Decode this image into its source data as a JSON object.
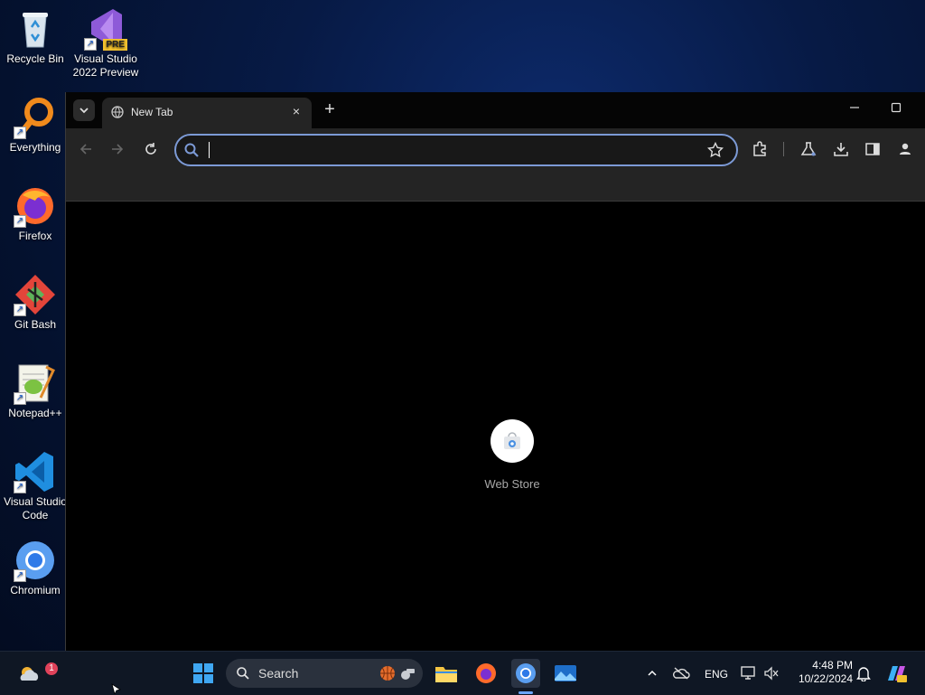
{
  "desktop": {
    "icons": [
      {
        "label": "Recycle Bin",
        "icon": "recycle-bin-icon"
      },
      {
        "label": "Visual Studio 2022 Preview",
        "icon": "visual-studio-icon",
        "badge": "PRE"
      },
      {
        "label": "Everything",
        "icon": "everything-search-icon"
      },
      {
        "label": "Firefox",
        "icon": "firefox-icon"
      },
      {
        "label": "Git Bash",
        "icon": "git-bash-icon"
      },
      {
        "label": "Notepad++",
        "icon": "notepad-plus-plus-icon"
      },
      {
        "label": "Visual Studio Code",
        "icon": "vscode-icon"
      },
      {
        "label": "Chromium",
        "icon": "chromium-icon"
      }
    ]
  },
  "browser": {
    "tab": {
      "title": "New Tab",
      "close": "×"
    },
    "new_tab_symbol": "+",
    "omnibox": {
      "value": "",
      "placeholder": ""
    },
    "new_tab_page": {
      "shortcuts": [
        {
          "label": "Web Store",
          "icon": "web-store-icon"
        }
      ]
    }
  },
  "taskbar": {
    "search_label": "Search",
    "notification_badge": "1",
    "tray": {
      "language": "ENG"
    },
    "clock": {
      "time": "4:48 PM",
      "date": "10/22/2024"
    }
  },
  "colors": {
    "accent": "#7c9ad6",
    "toolbar_bg": "#242424",
    "taskbar_bg": "#0f1724"
  }
}
